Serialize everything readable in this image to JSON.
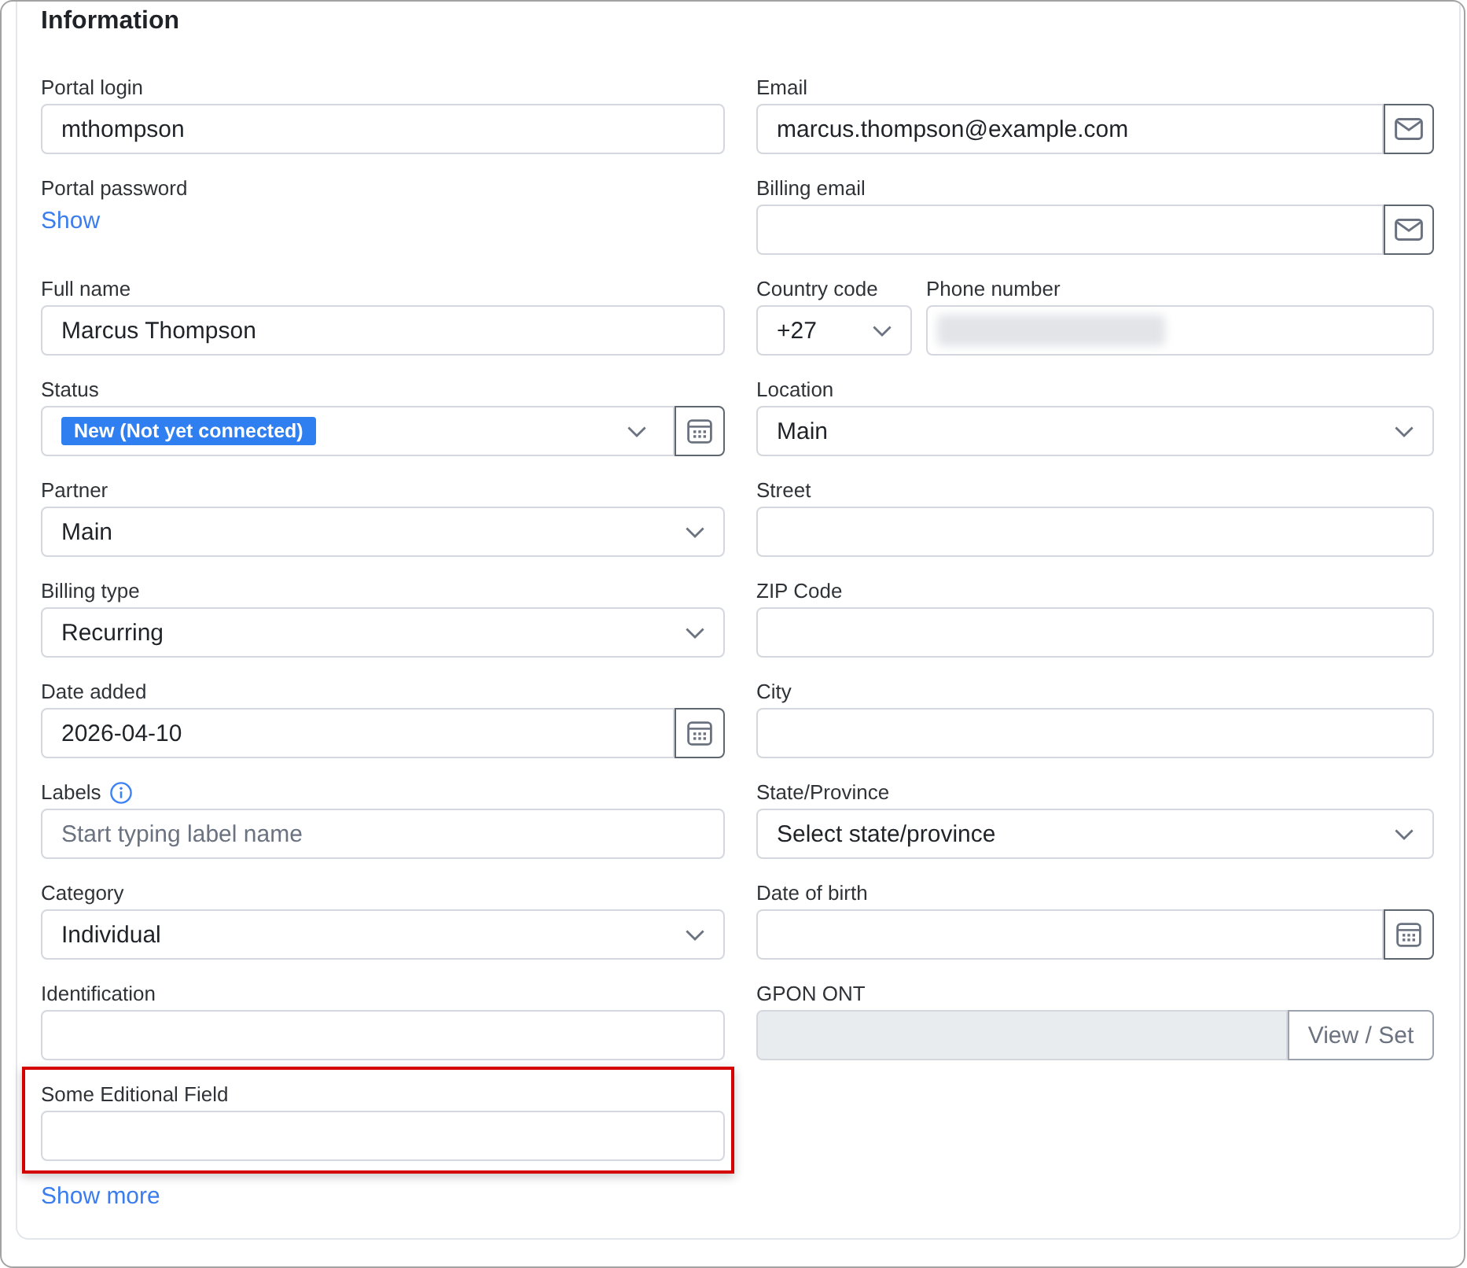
{
  "section": {
    "title": "Information"
  },
  "left_column": [
    {
      "kind": "input",
      "label": "Portal login",
      "value": "mthompson",
      "highlighted": false
    },
    {
      "kind": "link",
      "label": "Portal password",
      "link": "Show",
      "highlighted": false
    },
    {
      "kind": "input",
      "label": "Full name",
      "value": "Marcus Thompson",
      "highlighted": false
    },
    {
      "kind": "status",
      "label": "Status",
      "badge": "New (Not yet connected)",
      "highlighted": false
    },
    {
      "kind": "select",
      "label": "Partner",
      "value": "Main",
      "highlighted": false
    },
    {
      "kind": "select",
      "label": "Billing type",
      "value": "Recurring",
      "highlighted": false
    },
    {
      "kind": "date",
      "label": "Date added",
      "value": "2026-04-10",
      "highlighted": false
    },
    {
      "kind": "input",
      "label": "Labels",
      "info": true,
      "placeholder": "Start typing label name",
      "highlighted": false
    },
    {
      "kind": "select",
      "label": "Category",
      "value": "Individual",
      "highlighted": false
    },
    {
      "kind": "input",
      "label": "Identification",
      "highlighted": false
    },
    {
      "kind": "input",
      "label": "Some Editional Field",
      "highlighted": true
    }
  ],
  "right_column": [
    {
      "kind": "email",
      "label": "Email",
      "value": "marcus.thompson@example.com"
    },
    {
      "kind": "email",
      "label": "Billing email"
    },
    {
      "kind": "phone",
      "country": {
        "label": "Country code",
        "value": "+27"
      },
      "phone": {
        "label": "Phone number",
        "redacted": true
      }
    },
    {
      "kind": "select",
      "label": "Location",
      "value": "Main"
    },
    {
      "kind": "input",
      "label": "Street"
    },
    {
      "kind": "input",
      "label": "ZIP Code"
    },
    {
      "kind": "input",
      "label": "City"
    },
    {
      "kind": "select",
      "label": "State/Province",
      "value": "Select state/province"
    },
    {
      "kind": "date",
      "label": "Date of birth"
    },
    {
      "kind": "action",
      "label": "GPON ONT",
      "disabled": true,
      "button": "View / Set"
    }
  ],
  "show_more": "Show more"
}
